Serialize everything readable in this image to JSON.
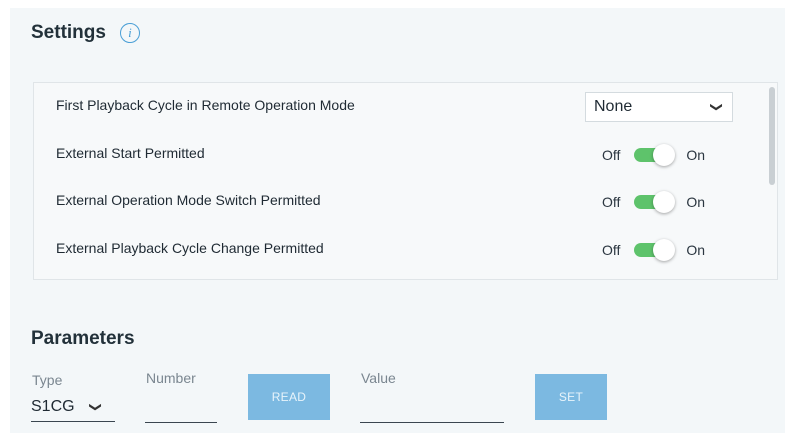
{
  "settings": {
    "title": "Settings",
    "info_glyph": "i",
    "rows": [
      {
        "label": "First Playback Cycle in Remote Operation Mode",
        "control": "select",
        "value": "None"
      },
      {
        "label": "External Start Permitted",
        "control": "toggle",
        "off_label": "Off",
        "on_label": "On",
        "state": true
      },
      {
        "label": "External Operation Mode Switch Permitted",
        "control": "toggle",
        "off_label": "Off",
        "on_label": "On",
        "state": true
      },
      {
        "label": "External Playback Cycle Change Permitted",
        "control": "toggle",
        "off_label": "Off",
        "on_label": "On",
        "state": true
      }
    ]
  },
  "parameters": {
    "title": "Parameters",
    "type_label": "Type",
    "type_value": "S1CG",
    "number_label": "Number",
    "number_value": "",
    "read_label": "READ",
    "value_label": "Value",
    "value_value": "",
    "set_label": "SET"
  },
  "colors": {
    "toggle_on": "#5ec36b",
    "button": "#7cb9e1",
    "info_icon": "#4a9fd6"
  },
  "icons": {
    "info": "info-icon",
    "dropdown": "chevron-down-icon"
  }
}
